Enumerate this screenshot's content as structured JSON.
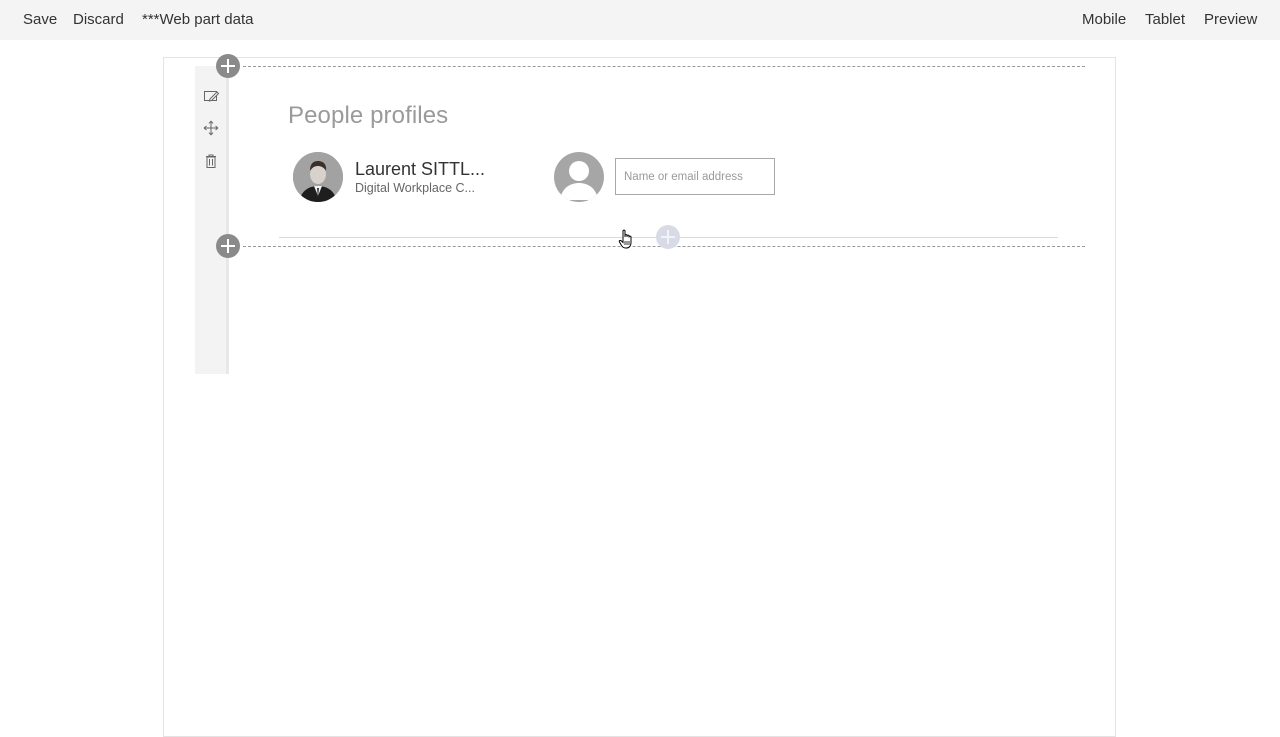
{
  "toolbar": {
    "save_label": "Save",
    "discard_label": "Discard",
    "webpart_data_label": "***Web part data",
    "mobile_label": "Mobile",
    "tablet_label": "Tablet",
    "preview_label": "Preview"
  },
  "rail": {
    "icons": [
      "edit-icon",
      "move-icon",
      "delete-icon"
    ]
  },
  "webpart": {
    "title": "People profiles",
    "people": [
      {
        "name": "Laurent SITTL...",
        "job_title": "Digital Workplace C..."
      }
    ],
    "picker": {
      "placeholder": "Name or email address",
      "value": ""
    }
  },
  "colors": {
    "toolbar_bg": "#f4f4f4",
    "add_button": "#8a8a8a",
    "title_gray": "#9a9a9a"
  }
}
